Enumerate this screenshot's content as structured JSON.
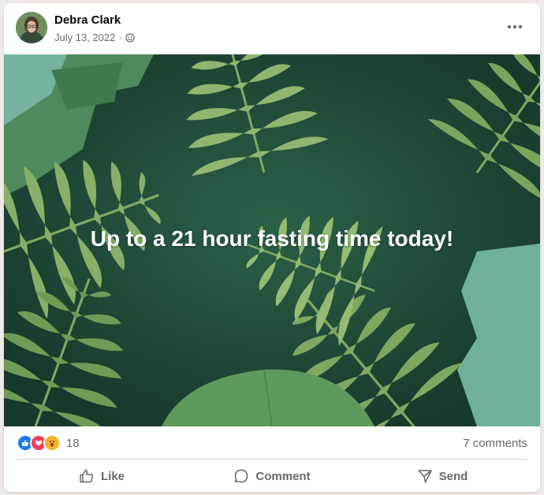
{
  "post": {
    "author": "Debra Clark",
    "date": "July 13, 2022",
    "separator": "·",
    "audience_icon": "friends-icon",
    "text": "Up to a 21 hour fasting time today!",
    "background_color": "#1f4a39"
  },
  "stats": {
    "reactions": [
      "like",
      "love",
      "wow"
    ],
    "reaction_count": "18",
    "comments": "7 comments"
  },
  "actions": {
    "like": "Like",
    "comment": "Comment",
    "send": "Send"
  }
}
